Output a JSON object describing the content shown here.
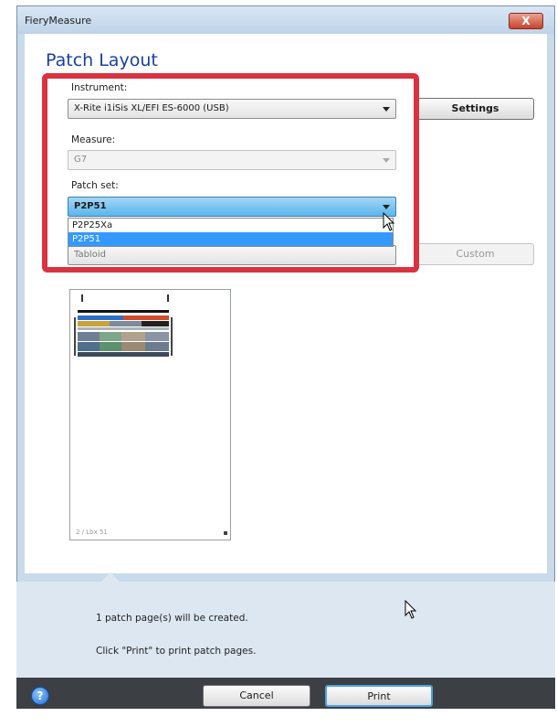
{
  "window": {
    "title": "FieryMeasure",
    "close_label": "X"
  },
  "page": {
    "heading": "Patch Layout"
  },
  "instrument": {
    "label": "Instrument:",
    "value": "X-Rite i1iSis XL/EFI ES-6000 (USB)",
    "settings_label": "Settings"
  },
  "measure": {
    "label": "Measure:",
    "value": "G7"
  },
  "patch_set": {
    "label": "Patch set:",
    "value": "P2P51",
    "options": [
      "P2P25Xa",
      "P2P51"
    ],
    "selected_option": "P2P51"
  },
  "chart_size": {
    "value": "Tabloid",
    "custom_label": "Custom"
  },
  "preview": {
    "caption": "2 / Lbx 51"
  },
  "info": {
    "pages_created": "1 patch page(s) will be created.",
    "print_hint": "Click \"Print\" to print patch pages."
  },
  "actions": {
    "cancel_label": "Cancel",
    "print_label": "Print",
    "help_symbol": "?"
  },
  "colors": {
    "accent": "#1b3ea4",
    "highlight_box": "#d9333f",
    "selection": "#3399ff",
    "bottom_bar": "#3c3f44"
  },
  "icons": [
    "close-icon",
    "dropdown-arrow-icon",
    "help-icon",
    "mouse-pointer-icon"
  ]
}
